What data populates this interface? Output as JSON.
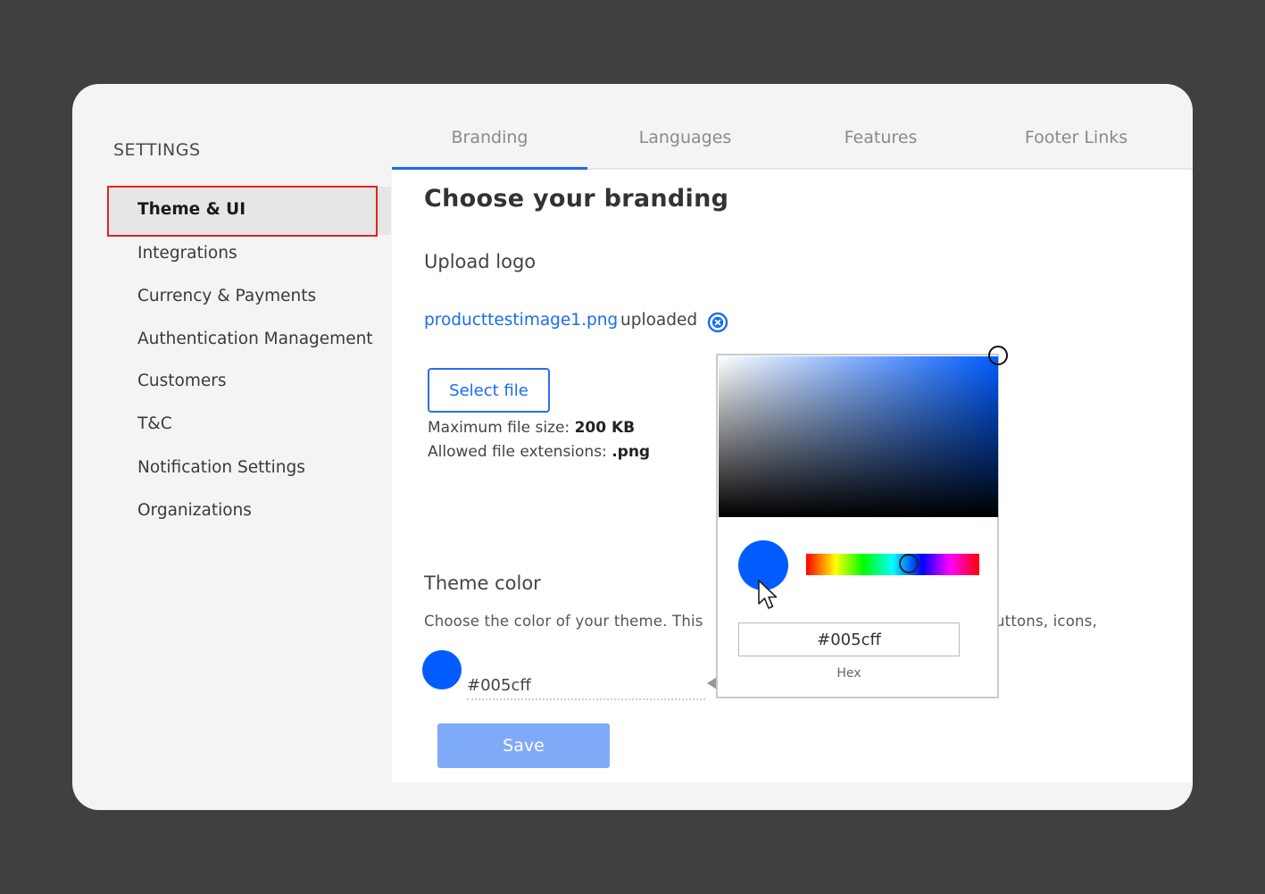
{
  "sidebar": {
    "heading": "SETTINGS",
    "items": [
      {
        "label": "Theme & UI"
      },
      {
        "label": "Integrations"
      },
      {
        "label": "Currency & Payments"
      },
      {
        "label": "Authentication Management"
      },
      {
        "label": "Customers"
      },
      {
        "label": "T&C"
      },
      {
        "label": "Notification Settings"
      },
      {
        "label": "Organizations"
      }
    ],
    "active_index": 0
  },
  "tabs": [
    {
      "label": "Branding"
    },
    {
      "label": "Languages"
    },
    {
      "label": "Features"
    },
    {
      "label": "Footer Links"
    }
  ],
  "active_tab": "Branding",
  "main": {
    "title": "Choose your branding",
    "logo": {
      "heading": "Upload logo",
      "file_name": "producttestimage1.png",
      "status": "uploaded",
      "remove_icon": "close-circle-icon",
      "select_button": "Select file",
      "max_size_label": "Maximum file size:",
      "max_size_value": "200 KB",
      "extensions_label": "Allowed file extensions:",
      "extensions_value": ".png"
    },
    "theme": {
      "heading": "Theme color",
      "description_start": "Choose the color of your theme. This",
      "description_end": "uttons, icons,",
      "hex_value": "#005cff"
    },
    "save_button": "Save"
  },
  "color_picker": {
    "hex_value": "#005cff",
    "hex_label": "Hex",
    "hue_level": 0.6
  },
  "colors": {
    "accent": "#005cff",
    "link": "#1a6cf0",
    "save_button_bg": "#7faaf8",
    "highlight_border": "#e02424",
    "background": "#404040"
  }
}
